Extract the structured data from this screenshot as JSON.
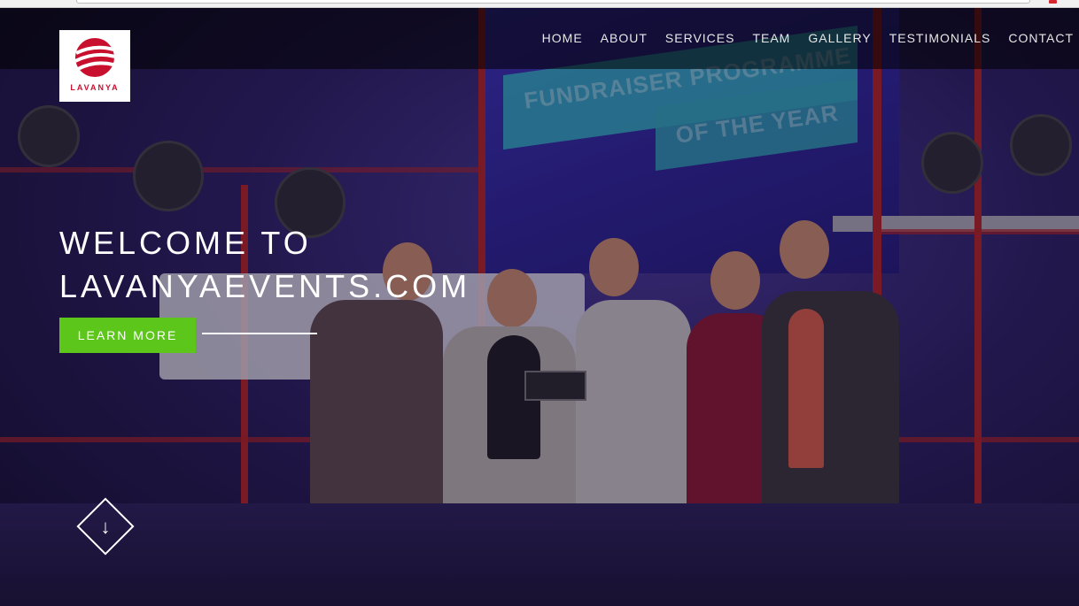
{
  "brand": {
    "logo_text": "LAVANYA",
    "accent_color": "#c8102e"
  },
  "nav": {
    "items": [
      "HOME",
      "ABOUT",
      "SERVICES",
      "TEAM",
      "GALLERY",
      "TESTIMONIALS",
      "CONTACT"
    ]
  },
  "hero": {
    "title_line1": "WELCOME TO",
    "title_line2": "LAVANYAEVENTS.COM",
    "cta_label": "LEARN MORE",
    "cta_color": "#5cc61a",
    "scroll_icon": "arrow-down-icon",
    "background_banner_line1": "FUNDRAISER PROGRAMME",
    "background_banner_line2": "OF THE YEAR"
  }
}
